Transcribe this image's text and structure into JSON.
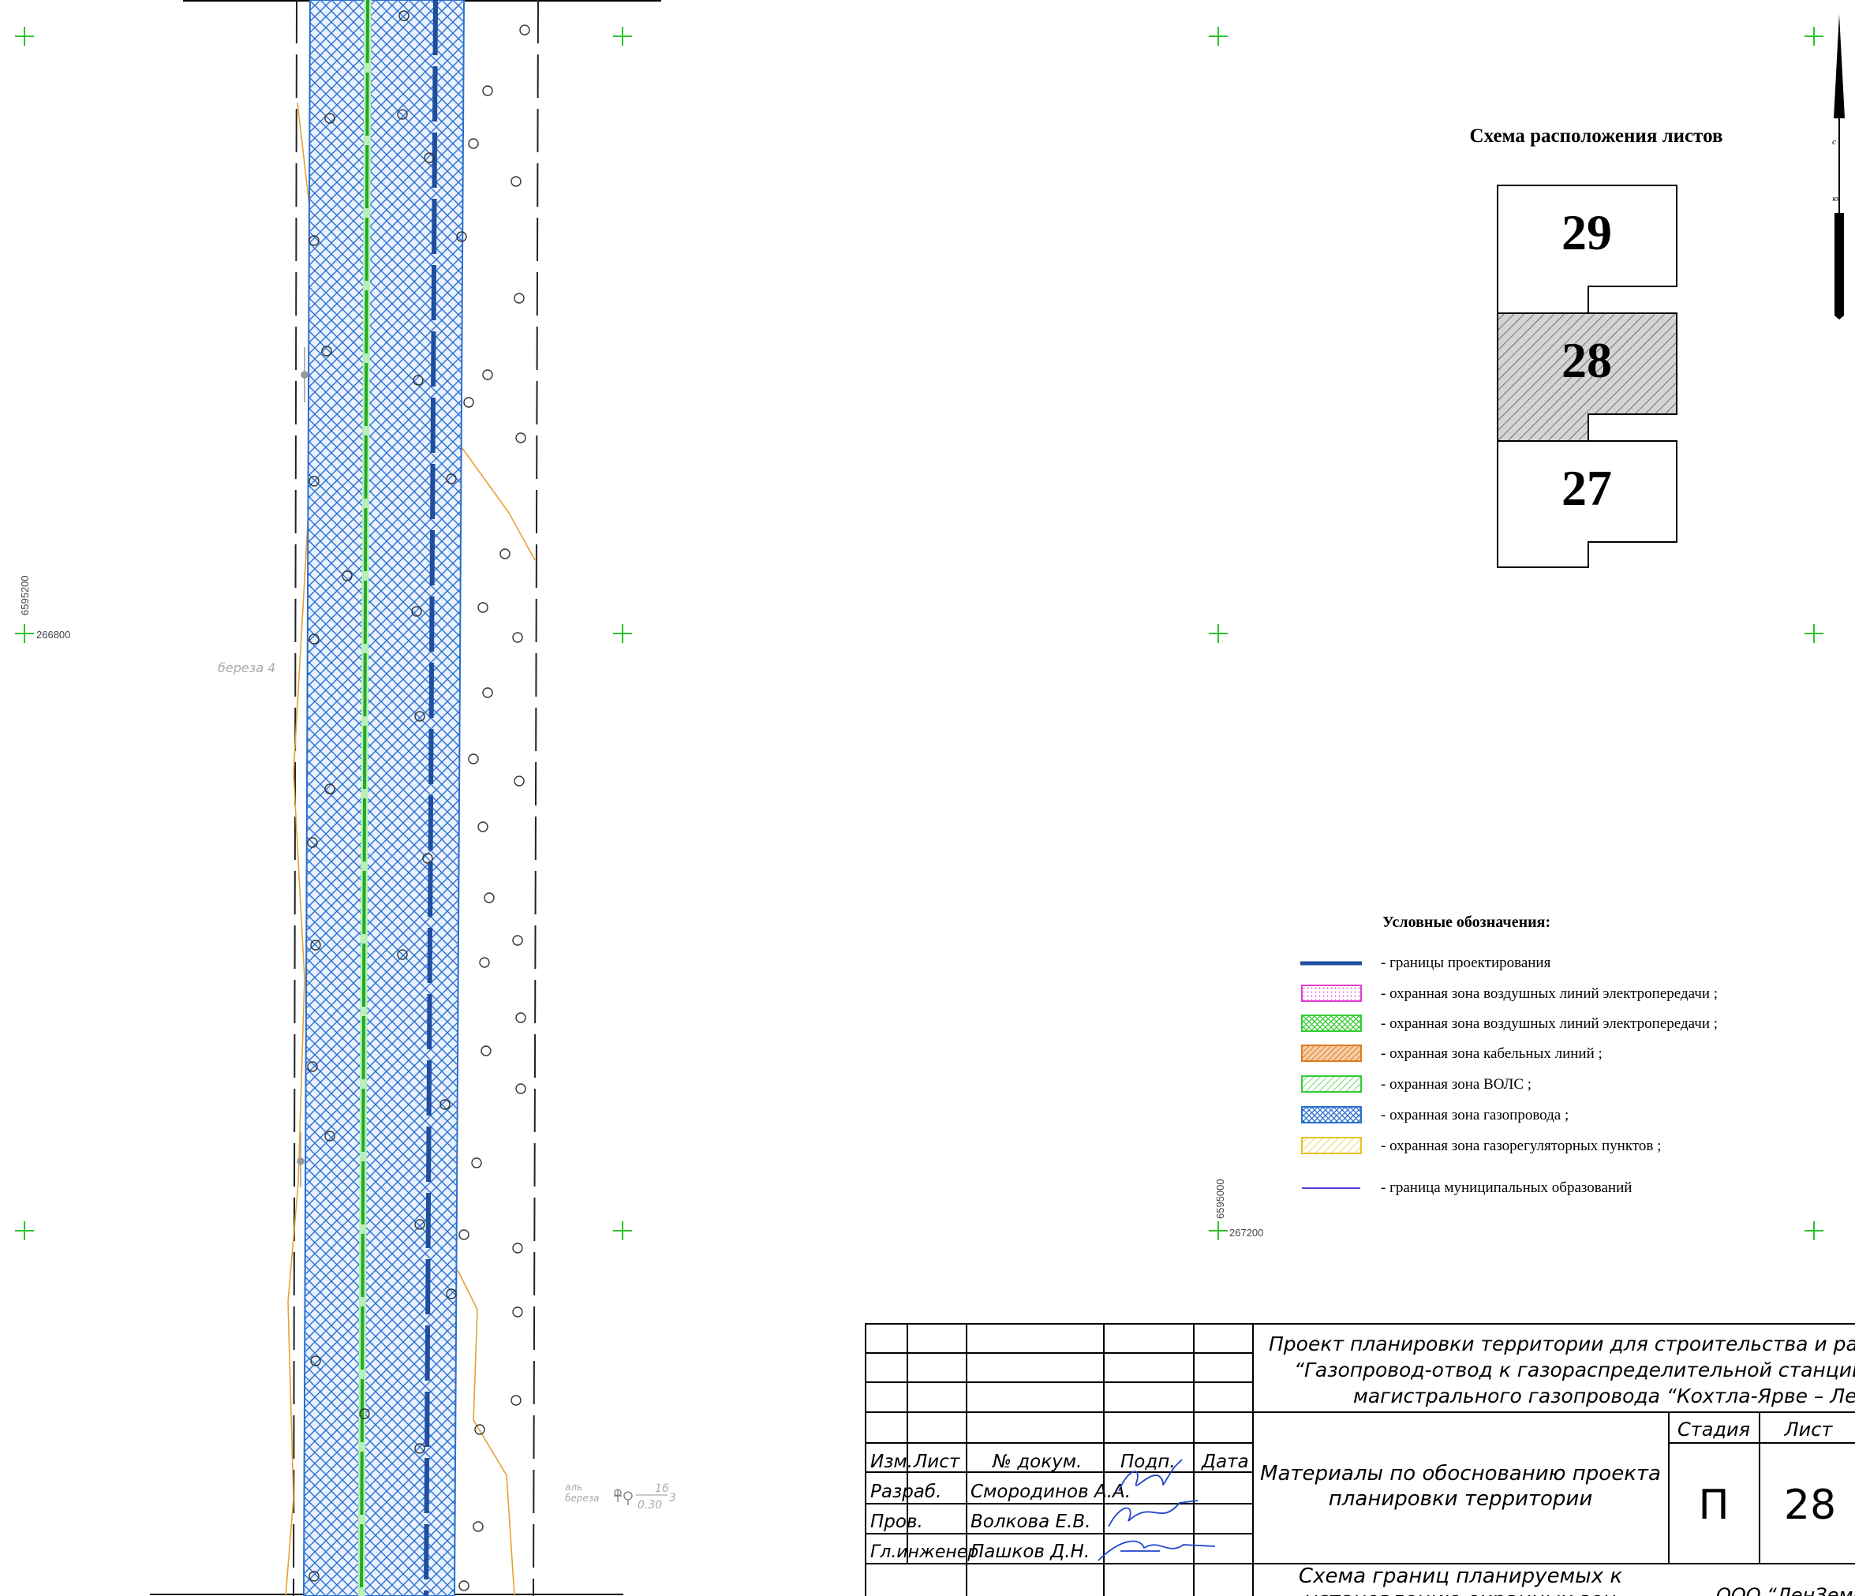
{
  "corridor": {
    "tree_label_left": "береза 4",
    "tree_label_right_top": "аль",
    "tree_label_right_bottom": "береза",
    "tree_value_num": "16",
    "tree_value_den": "0.30",
    "tree_value_suffix": "3"
  },
  "grid_labels": {
    "left_north": "6595200",
    "left_east": "266800",
    "right_north": "6595000",
    "right_east": "267200"
  },
  "sheet_scheme": {
    "title": "Схема расположения листов",
    "sheets": [
      "29",
      "28",
      "27"
    ],
    "current_sheet": "28"
  },
  "legend": {
    "title": "Условные обозначения:",
    "items": [
      {
        "label": "- границы проектирования",
        "color": "#1f4e9e",
        "symbol": "thick-line"
      },
      {
        "label": "- охранная зона воздушных линий электропередачи ;",
        "color": "#e040d0",
        "symbol": "dotted-box"
      },
      {
        "label": "- охранная зона воздушных линий электропередачи ;",
        "color": "#33cc33",
        "symbol": "cross-hatch-box"
      },
      {
        "label": "- охранная зона кабельных линий ;",
        "color": "#e07a20",
        "symbol": "diagonal-hatch-box"
      },
      {
        "label": "- охранная зона ВОЛС ;",
        "color": "#33cc33",
        "symbol": "diagonal-hatch-box-light"
      },
      {
        "label": "- охранная зона газопровода ;",
        "color": "#2a6fd0",
        "symbol": "cross-hatch-box"
      },
      {
        "label": "- охранная зона газорегуляторных пунктов ;",
        "color": "#e8c020",
        "symbol": "diagonal-hatch-box"
      },
      {
        "label": "- граница муниципальных образований",
        "color": "#5a3fd8",
        "symbol": "thin-line"
      }
    ]
  },
  "title_block": {
    "project_line1": "Проект планировки территории для строительства и размещения",
    "project_line2": "“Газопровод-отвод к газораспределительной станции “Усть-Л",
    "project_line3": "магистрального газопровода “Кохтла-Ярве – Ленинград",
    "col_izm": "Изм.",
    "col_list": "Лист",
    "col_doc": "№ докум.",
    "col_sign": "Подп.",
    "col_date": "Дата",
    "rows": [
      {
        "role": "Разраб.",
        "name": "Смородинов А.А."
      },
      {
        "role": "Пров.",
        "name": "Волкова Е.В."
      },
      {
        "role": "Гл.инженер",
        "name": "Пашков Д.Н."
      }
    ],
    "section_title_line1": "Материалы по обоснованию проекта",
    "section_title_line2": "планировки территории",
    "stage_header": "Стадия",
    "sheet_header": "Лист",
    "stage_value": "П",
    "sheet_value": "28",
    "drawing_title_line1": "Схема границ планируемых к",
    "drawing_title_line2": "установлению охранных зон",
    "company": "ООО “ЛенЗемКа"
  }
}
